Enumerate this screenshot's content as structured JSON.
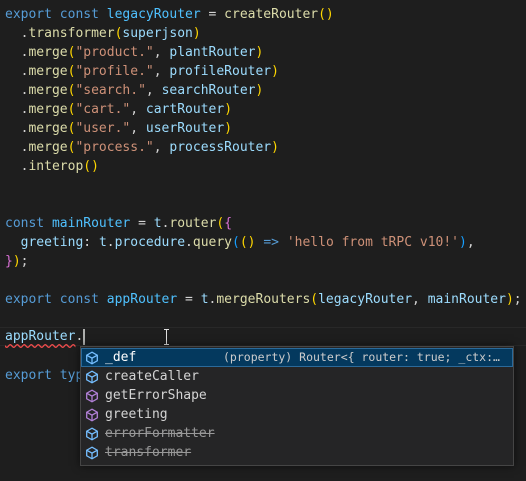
{
  "editor": {
    "lines": [
      {
        "tokens": [
          [
            "export",
            "kw"
          ],
          [
            " ",
            "punc"
          ],
          [
            "const",
            "kw"
          ],
          [
            " ",
            "punc"
          ],
          [
            "legacyRouter",
            "cst"
          ],
          [
            " = ",
            "punc"
          ],
          [
            "createRouter",
            "fn"
          ],
          [
            "()",
            "b1"
          ]
        ]
      },
      {
        "tokens": [
          [
            "  .",
            "punc"
          ],
          [
            "transformer",
            "fn"
          ],
          [
            "(",
            "b1"
          ],
          [
            "superjson",
            "var"
          ],
          [
            ")",
            "b1"
          ]
        ]
      },
      {
        "tokens": [
          [
            "  .",
            "punc"
          ],
          [
            "merge",
            "fn"
          ],
          [
            "(",
            "b1"
          ],
          [
            "\"product.\"",
            "str"
          ],
          [
            ", ",
            "punc"
          ],
          [
            "plantRouter",
            "var"
          ],
          [
            ")",
            "b1"
          ]
        ]
      },
      {
        "tokens": [
          [
            "  .",
            "punc"
          ],
          [
            "merge",
            "fn"
          ],
          [
            "(",
            "b1"
          ],
          [
            "\"profile.\"",
            "str"
          ],
          [
            ", ",
            "punc"
          ],
          [
            "profileRouter",
            "var"
          ],
          [
            ")",
            "b1"
          ]
        ]
      },
      {
        "tokens": [
          [
            "  .",
            "punc"
          ],
          [
            "merge",
            "fn"
          ],
          [
            "(",
            "b1"
          ],
          [
            "\"search.\"",
            "str"
          ],
          [
            ", ",
            "punc"
          ],
          [
            "searchRouter",
            "var"
          ],
          [
            ")",
            "b1"
          ]
        ]
      },
      {
        "tokens": [
          [
            "  .",
            "punc"
          ],
          [
            "merge",
            "fn"
          ],
          [
            "(",
            "b1"
          ],
          [
            "\"cart.\"",
            "str"
          ],
          [
            ", ",
            "punc"
          ],
          [
            "cartRouter",
            "var"
          ],
          [
            ")",
            "b1"
          ]
        ]
      },
      {
        "tokens": [
          [
            "  .",
            "punc"
          ],
          [
            "merge",
            "fn"
          ],
          [
            "(",
            "b1"
          ],
          [
            "\"user.\"",
            "str"
          ],
          [
            ", ",
            "punc"
          ],
          [
            "userRouter",
            "var"
          ],
          [
            ")",
            "b1"
          ]
        ]
      },
      {
        "tokens": [
          [
            "  .",
            "punc"
          ],
          [
            "merge",
            "fn"
          ],
          [
            "(",
            "b1"
          ],
          [
            "\"process.\"",
            "str"
          ],
          [
            ", ",
            "punc"
          ],
          [
            "processRouter",
            "var"
          ],
          [
            ")",
            "b1"
          ]
        ]
      },
      {
        "tokens": [
          [
            "  .",
            "punc"
          ],
          [
            "interop",
            "fn"
          ],
          [
            "()",
            "b1"
          ]
        ]
      },
      {
        "tokens": []
      },
      {
        "tokens": []
      },
      {
        "tokens": [
          [
            "const",
            "kw"
          ],
          [
            " ",
            "punc"
          ],
          [
            "mainRouter",
            "cst"
          ],
          [
            " = ",
            "punc"
          ],
          [
            "t",
            "var"
          ],
          [
            ".",
            "punc"
          ],
          [
            "router",
            "fn"
          ],
          [
            "(",
            "b1"
          ],
          [
            "{",
            "b2"
          ]
        ]
      },
      {
        "tokens": [
          [
            "  ",
            "punc"
          ],
          [
            "greeting",
            "var"
          ],
          [
            ": ",
            "punc"
          ],
          [
            "t",
            "var"
          ],
          [
            ".",
            "punc"
          ],
          [
            "procedure",
            "var"
          ],
          [
            ".",
            "punc"
          ],
          [
            "query",
            "fn"
          ],
          [
            "(",
            "b3"
          ],
          [
            "()",
            "b1"
          ],
          [
            " ",
            "punc"
          ],
          [
            "=>",
            "kw"
          ],
          [
            " ",
            "punc"
          ],
          [
            "'hello from tRPC v10!'",
            "str"
          ],
          [
            ")",
            "b3"
          ],
          [
            ",",
            "punc"
          ]
        ]
      },
      {
        "tokens": [
          [
            "}",
            "b2"
          ],
          [
            ")",
            "b1"
          ],
          [
            ";",
            "punc"
          ]
        ]
      },
      {
        "tokens": []
      },
      {
        "tokens": [
          [
            "export",
            "kw"
          ],
          [
            " ",
            "punc"
          ],
          [
            "const",
            "kw"
          ],
          [
            " ",
            "punc"
          ],
          [
            "appRouter",
            "cst"
          ],
          [
            " = ",
            "punc"
          ],
          [
            "t",
            "var"
          ],
          [
            ".",
            "punc"
          ],
          [
            "mergeRouters",
            "fn"
          ],
          [
            "(",
            "b1"
          ],
          [
            "legacyRouter",
            "var"
          ],
          [
            ", ",
            "punc"
          ],
          [
            "mainRouter",
            "var"
          ],
          [
            ")",
            "b1"
          ],
          [
            ";",
            "punc"
          ]
        ]
      },
      {
        "tokens": []
      }
    ],
    "current_line": {
      "object": "appRouter",
      "dot": "."
    },
    "last_line": {
      "keyword": "export",
      "partial": "typ"
    }
  },
  "suggest": {
    "items": [
      {
        "label": "_def",
        "detail": "(property) Router<{ router: true; _ctx: {…",
        "icon": "property-icon",
        "selected": true,
        "deprecated": false
      },
      {
        "label": "createCaller",
        "detail": "",
        "icon": "property-icon",
        "selected": false,
        "deprecated": false
      },
      {
        "label": "getErrorShape",
        "detail": "",
        "icon": "method-icon",
        "selected": false,
        "deprecated": false
      },
      {
        "label": "greeting",
        "detail": "",
        "icon": "method-icon",
        "selected": false,
        "deprecated": false
      },
      {
        "label": "errorFormatter",
        "detail": "",
        "icon": "property-icon",
        "selected": false,
        "deprecated": true
      },
      {
        "label": "transformer",
        "detail": "",
        "icon": "property-icon",
        "selected": false,
        "deprecated": true
      }
    ]
  },
  "colors": {
    "background": "#1e1e1e",
    "keyword": "#569cd6",
    "variable": "#9cdcfe",
    "constant": "#4fc1ff",
    "function": "#dcdcaa",
    "string": "#ce9178",
    "selection": "#04395e",
    "error": "#f14c4c"
  }
}
